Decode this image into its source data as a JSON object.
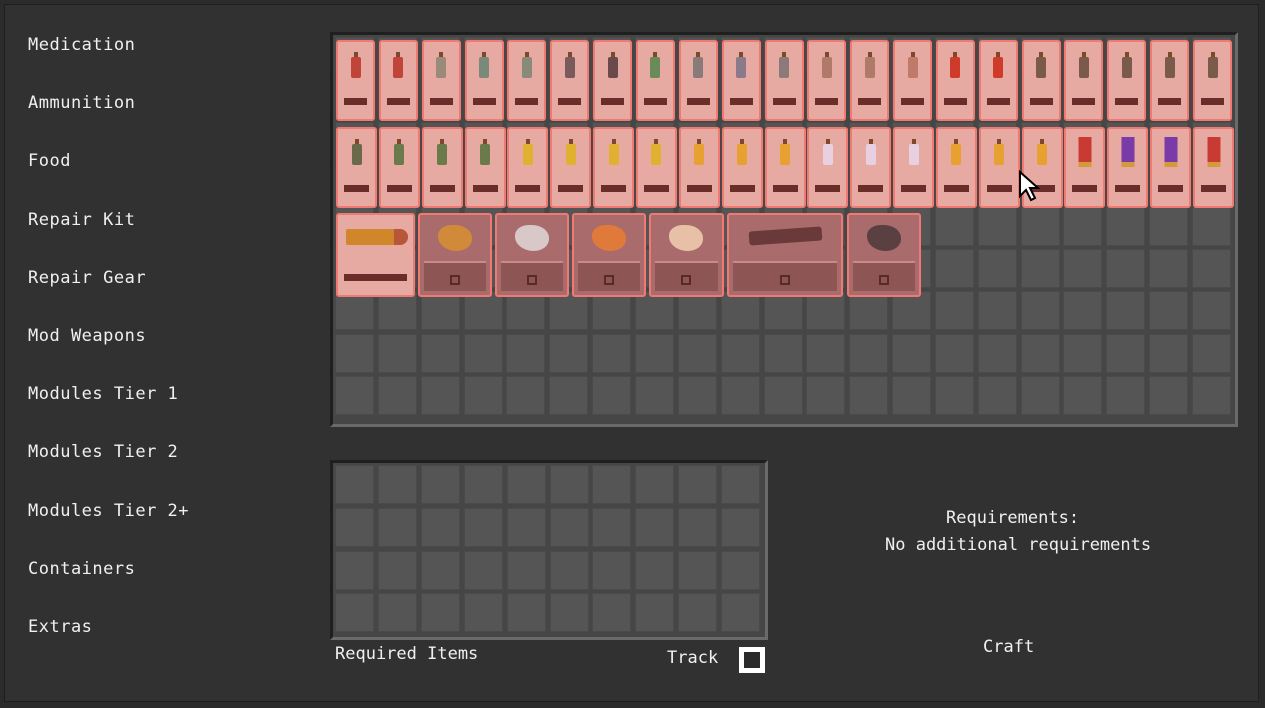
{
  "categories": [
    {
      "label": "Medication"
    },
    {
      "label": "Ammunition"
    },
    {
      "label": "Food"
    },
    {
      "label": "Repair Kit"
    },
    {
      "label": "Repair Gear"
    },
    {
      "label": "Mod Weapons"
    },
    {
      "label": "Modules Tier 1"
    },
    {
      "label": "Modules Tier 2"
    },
    {
      "label": "Modules Tier 2+"
    },
    {
      "label": "Containers"
    },
    {
      "label": "Extras"
    }
  ],
  "inventory": {
    "row1_colors": [
      "#c0443a",
      "#c0443a",
      "#9a8a7a",
      "#7a8a7a",
      "#8a8a7a",
      "#7a5a5a",
      "#6a4a4a",
      "#6a8a5a",
      "#8a7a7a",
      "#8a7a8a",
      "#8a7a7a",
      "#b07a6a",
      "#b07a6a",
      "#c07a6a",
      "#d03a2a",
      "#d03a2a",
      "#7a5a4a",
      "#7a5a4a",
      "#7a5a4a",
      "#7a5a4a",
      "#7a5a4a"
    ],
    "row2_colors": [
      "#6a6a4a",
      "#6a7a4a",
      "#6a7a4a",
      "#6a7a4a",
      "#e0b030",
      "#e0b030",
      "#e0b030",
      "#e0b030",
      "#e8a030",
      "#e8a030",
      "#e8a030",
      "#e8d0e0",
      "#e8d0e0",
      "#e8d0e0",
      "#e8a030",
      "#e8a030",
      "#e8a030"
    ],
    "shell_colors": [
      "#c83a32",
      "#7a3aa8",
      "#7a3aa8",
      "#c83a32"
    ],
    "large_items": [
      {
        "icon": "bullet-cartridge-icon"
      },
      {
        "icon": "orange-debris-icon",
        "color": "#d08a3a"
      },
      {
        "icon": "grey-scrap-icon",
        "color": "#d8c8c8"
      },
      {
        "icon": "colorful-parts-icon",
        "color": "#e07a3a"
      },
      {
        "icon": "pale-parts-icon",
        "color": "#e8c0a8"
      },
      {
        "icon": "rifle-parts-icon",
        "color": "#6a3a3a"
      },
      {
        "icon": "dark-scrap-icon",
        "color": "#5a4040"
      }
    ]
  },
  "required": {
    "label": "Required Items"
  },
  "track": {
    "label": "Track"
  },
  "requirements": {
    "title": "Requirements:",
    "text": "No additional requirements"
  },
  "craft": {
    "label": "Craft"
  }
}
